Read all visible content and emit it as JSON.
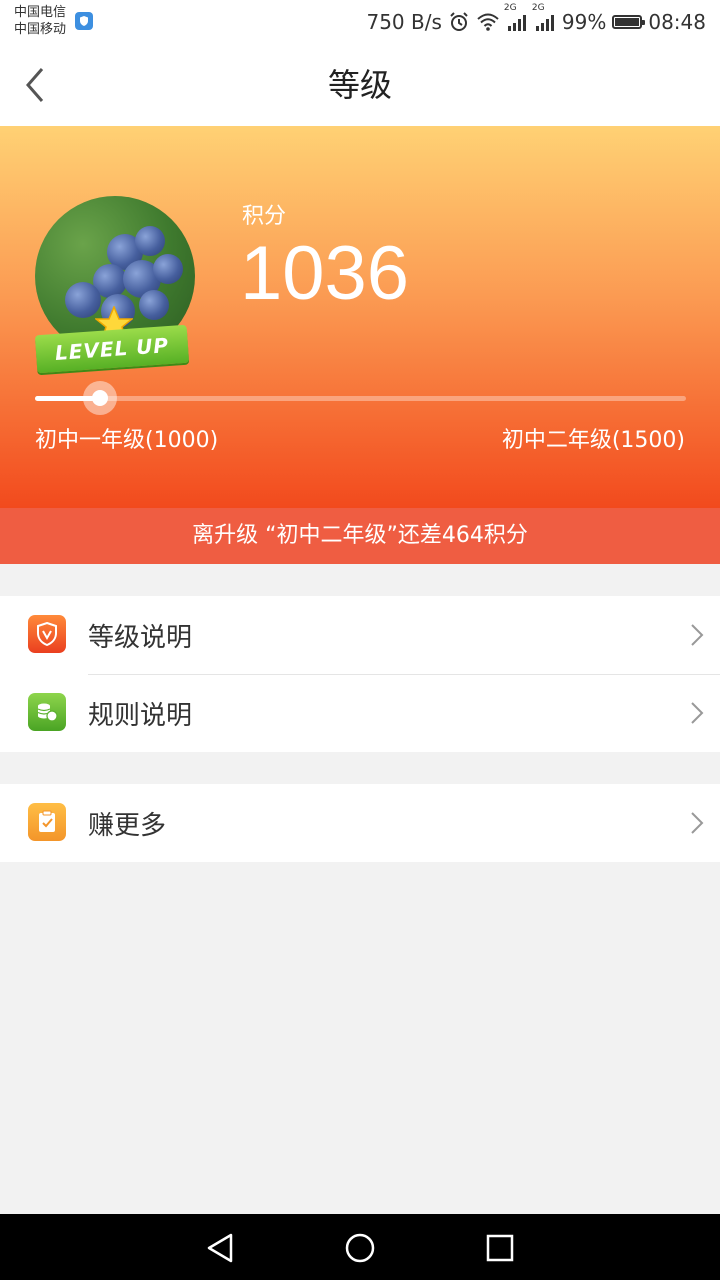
{
  "status_bar": {
    "carrier_1": "中国电信",
    "carrier_2": "中国移动",
    "net_speed": "750 B/s",
    "signal_1_label": "2G",
    "signal_2_label": "2G",
    "battery": "99%",
    "battery_level": 0.99,
    "time": "08:48",
    "icons": [
      "shield-icon",
      "alarm-icon",
      "wifi-icon",
      "signal-icon",
      "battery-icon"
    ]
  },
  "nav": {
    "title": "等级",
    "back_icon": "chevron-left-icon"
  },
  "hero": {
    "badge_text": "LEVEL UP",
    "score_label": "积分",
    "score_value": "1036",
    "current_level": "初中一年级(1000)",
    "next_level": "初中二年级(1500)",
    "progress_fraction": 0.1,
    "colors": {
      "top": "#ffd174",
      "bottom": "#f24a1d"
    }
  },
  "notice": {
    "text": "离升级 “初中二年级”还差464积分"
  },
  "menu": {
    "group_1": [
      {
        "label": "等级说明",
        "icon": "shield-v-icon",
        "color": "#f0542a"
      },
      {
        "label": "规则说明",
        "icon": "coins-icon",
        "color": "#5cb130"
      }
    ],
    "group_2": [
      {
        "label": "赚更多",
        "icon": "clipboard-check-icon",
        "color": "#f7a631"
      }
    ]
  },
  "system_nav": {
    "icons": [
      "back-triangle-icon",
      "home-circle-icon",
      "recent-square-icon"
    ]
  }
}
